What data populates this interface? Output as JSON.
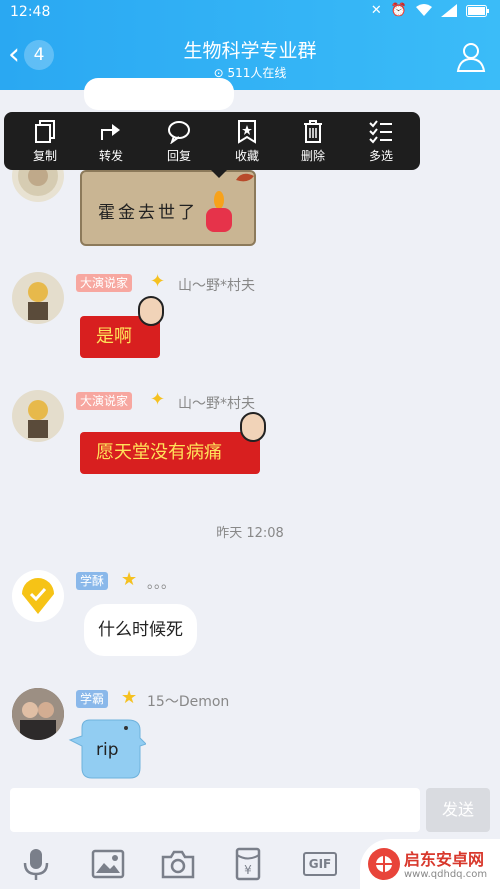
{
  "status": {
    "time": "12:48"
  },
  "header": {
    "back_badge": "4",
    "title": "生物科学专业群",
    "online": "511人在线"
  },
  "context_menu": {
    "items": [
      {
        "label": "复制",
        "icon": "copy-icon"
      },
      {
        "label": "转发",
        "icon": "forward-icon"
      },
      {
        "label": "回复",
        "icon": "reply-icon"
      },
      {
        "label": "收藏",
        "icon": "favorite-icon"
      },
      {
        "label": "删除",
        "icon": "delete-icon"
      },
      {
        "label": "多选",
        "icon": "multiselect-icon"
      }
    ]
  },
  "messages": {
    "m1": {
      "text": "霍金去世了"
    },
    "m2": {
      "tag": "大演说家",
      "nick": "山～野*村夫",
      "text": "是啊"
    },
    "m3": {
      "tag": "大演说家",
      "nick": "山～野*村夫",
      "text": "愿天堂没有病痛"
    },
    "timestamp": "昨天 12:08",
    "m4": {
      "tag": "学酥",
      "nick": "。。。",
      "text": "什么时候死"
    },
    "m5": {
      "tag": "学霸",
      "nick": "15～Demon",
      "text": "rip"
    }
  },
  "input": {
    "send_label": "发送",
    "value": ""
  },
  "toolbar": {
    "gif_label": "GIF"
  },
  "watermark": {
    "title": "启东安卓网",
    "url": "www.qdhdq.com"
  },
  "colors": {
    "accent": "#2aa8f2",
    "red_bubble": "#d81f1f",
    "menu_bg": "#1e1e1e"
  }
}
